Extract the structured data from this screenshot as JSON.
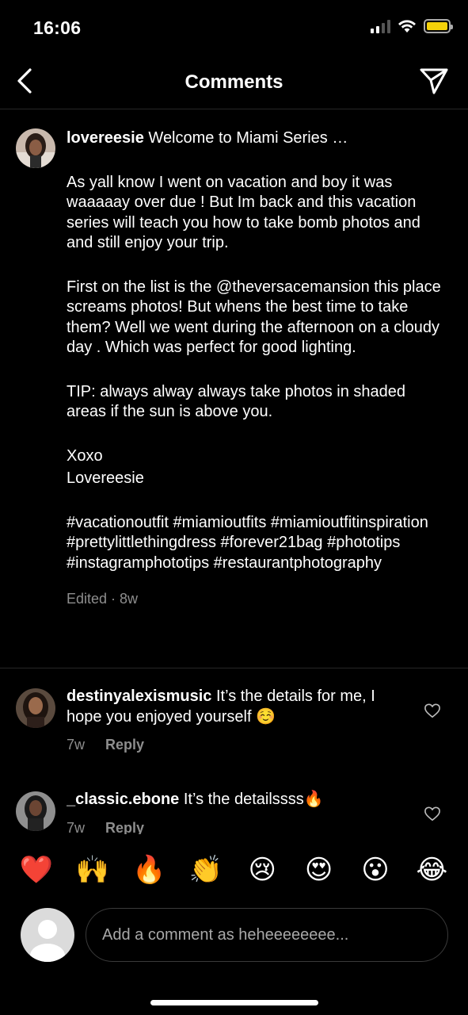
{
  "status": {
    "time": "16:06",
    "battery_color": "#f5d20a"
  },
  "header": {
    "title": "Comments",
    "back_icon": "chevron-left-icon",
    "share_icon": "paper-plane-icon"
  },
  "caption": {
    "username": "lovereesie",
    "first_line": "Welcome to Miami Series …",
    "paragraphs": [
      "As yall know I went on vacation and boy it was waaaaay over due !  But Im back and this vacation series will teach you how to take bomb photos and and still enjoy your trip.",
      "First on the list is the @theversacemansion this place screams photos! But whens the best time to take them? Well we went during the afternoon on a cloudy day . Which was perfect for good lighting.",
      "TIP: always alway always take photos in shaded areas if the sun is above you."
    ],
    "signoff_1": "Xoxo",
    "signoff_2": "Lovereesie",
    "hashtags": "#vacationoutfit #miamioutfits #miamioutfitinspiration #prettylittlethingdress #forever21bag #phototips #instagramphototips #restaurantphotography",
    "edited": "Edited · 8w"
  },
  "comments": [
    {
      "username": "destinyalexismusic",
      "text": "It’s the details for me, I hope you enjoyed yourself ☺️",
      "age": "7w",
      "reply_label": "Reply"
    },
    {
      "username": "_classic.ebone",
      "text": "It’s the detailssss🔥",
      "age": "7w",
      "reply_label": "Reply"
    }
  ],
  "emoji_bar": [
    "❤️",
    "🙌",
    "🔥",
    "👏",
    "😢",
    "😍",
    "😮",
    "😂"
  ],
  "composer": {
    "placeholder": "Add a comment as heheeeeeeee..."
  }
}
